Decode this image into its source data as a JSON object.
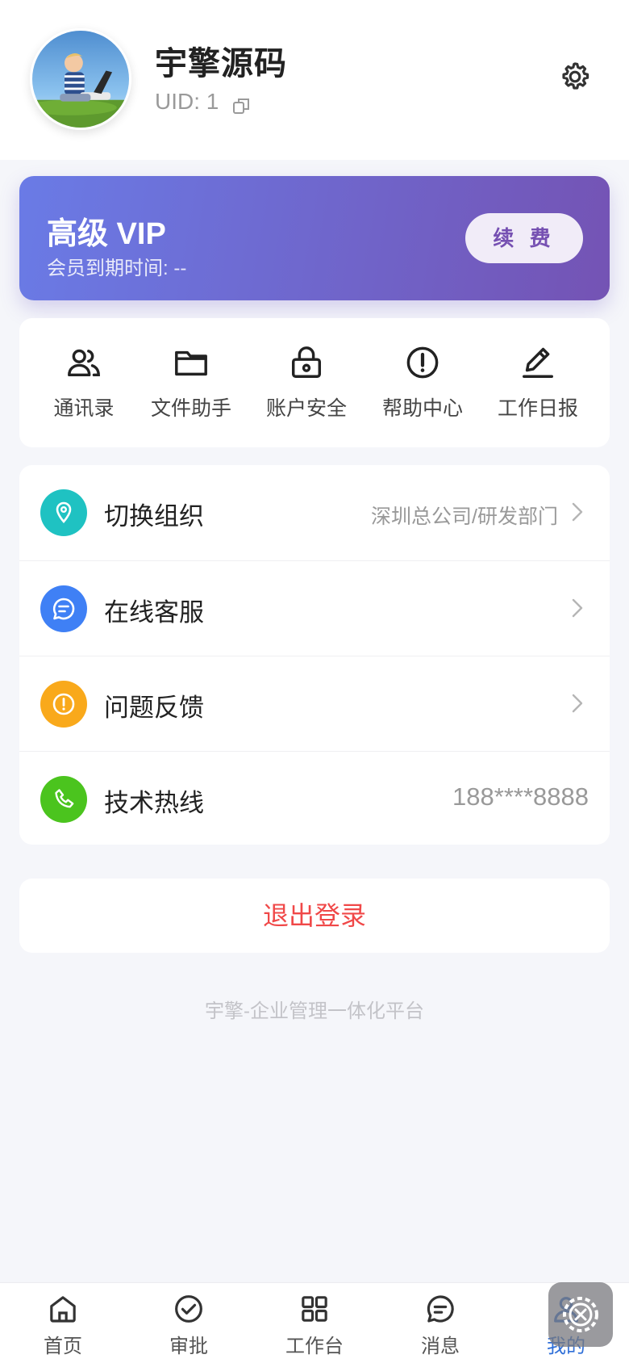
{
  "profile": {
    "name": "宇擎源码",
    "uid_label": "UID: 1"
  },
  "vip": {
    "title": "高级 VIP",
    "expire": "会员到期时间: --",
    "renew_label": "续 费"
  },
  "shortcuts": [
    {
      "label": "通讯录",
      "icon": "contacts-icon"
    },
    {
      "label": "文件助手",
      "icon": "folder-icon"
    },
    {
      "label": "账户安全",
      "icon": "lock-icon"
    },
    {
      "label": "帮助中心",
      "icon": "alert-circle-icon"
    },
    {
      "label": "工作日报",
      "icon": "edit-icon"
    }
  ],
  "menu": [
    {
      "label": "切换组织",
      "value": "深圳总公司/研发部门",
      "icon": "location-icon",
      "color": "#1fc2c2"
    },
    {
      "label": "在线客服",
      "value": "",
      "icon": "chat-icon",
      "color": "#3f80f5"
    },
    {
      "label": "问题反馈",
      "value": "",
      "icon": "alert-icon",
      "color": "#f9a91b"
    },
    {
      "label": "技术热线",
      "value": "188****8888",
      "icon": "phone-icon",
      "color": "#4bc41e"
    }
  ],
  "logout_label": "退出登录",
  "footer": "宇擎-企业管理一体化平台",
  "tabbar": [
    {
      "label": "首页",
      "icon": "home-icon"
    },
    {
      "label": "审批",
      "icon": "check-circle-icon"
    },
    {
      "label": "工作台",
      "icon": "grid-icon"
    },
    {
      "label": "消息",
      "icon": "message-icon"
    },
    {
      "label": "我的",
      "icon": "user-icon",
      "active": true
    }
  ],
  "colors": {
    "accent": "#2f6fd8",
    "danger": "#f04848",
    "vip_start": "#6a7be6",
    "vip_end": "#7453b4"
  }
}
